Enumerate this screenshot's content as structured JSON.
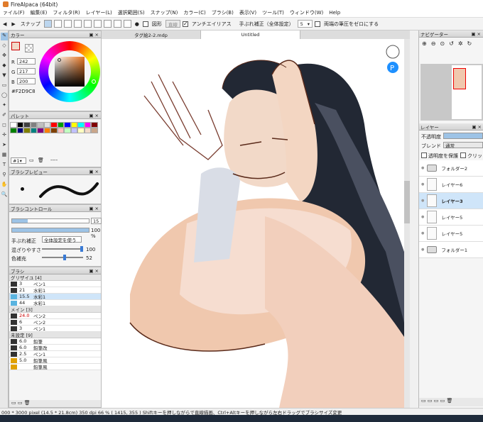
{
  "window": {
    "title": "FireAlpaca (64bit)"
  },
  "menu": [
    "ァイル(F)",
    "編集(E)",
    "フィルタ(R)",
    "レイヤー(L)",
    "選択範囲(S)",
    "スナップ(N)",
    "カラー(C)",
    "ブラシ(B)",
    "表示(V)",
    "ツール(T)",
    "ウィンドウ(W)",
    "Help"
  ],
  "toolbar": {
    "snap_label": "スナップ",
    "shape_label": "図形",
    "shape_select": "直線",
    "antialias_label": "アンチエイリアス",
    "stabilizer_label": "手ぶれ補正（全体設定）",
    "stabilizer_value": "5",
    "pressure_label": "両端の筆圧をゼロにする"
  },
  "color_panel": {
    "title": "カラー",
    "r_label": "R",
    "r": "242",
    "g_label": "G",
    "g": "217",
    "b_label": "B",
    "b": "200",
    "hex": "#F2D9C8"
  },
  "palette_panel": {
    "title": "パレット",
    "swatches": [
      "#ffffff",
      "#000000",
      "#404040",
      "#808080",
      "#c0c0c0",
      "#e0e0e0",
      "#ff0000",
      "#00a000",
      "#0000ff",
      "#ffff00",
      "#00ffff",
      "#ff00ff",
      "#800000",
      "#008000",
      "#000080",
      "#808000",
      "#008080",
      "#800080",
      "#ff8000",
      "#804000",
      "#ffc0c0",
      "#c0ffc0",
      "#c0c0ff",
      "#ffffc0",
      "#f2d9c8",
      "#caa68a"
    ],
    "select_value": "#1",
    "placeholder": "----"
  },
  "brush_preview": {
    "title": "ブラシプレビュー"
  },
  "brush_control": {
    "title": "ブラシコントロール",
    "size": "15",
    "opacity": "100 %",
    "stabilizer_label": "手ぶれ補正",
    "stabilizer_value": "全体設定を使う",
    "blend_label": "混ざりやすさ",
    "blend_value": "100",
    "color_label": "色補充",
    "color_value": "52"
  },
  "brush_panel": {
    "title": "ブラシ",
    "groups": [
      {
        "name": "グリザイユ [4]",
        "items": [
          {
            "size": "3",
            "name": "ペン1",
            "color": "#333333"
          },
          {
            "size": "21",
            "name": "水彩1",
            "color": "#333333"
          },
          {
            "size": "15.5",
            "name": "水彩1",
            "color": "#5ab4e0",
            "selected": true
          },
          {
            "size": "44",
            "name": "水彩1",
            "color": "#5ab4e0"
          }
        ]
      },
      {
        "name": "メイン [3]",
        "items": [
          {
            "size": "24.0",
            "name": "ペン2",
            "color": "#333333",
            "red": true
          },
          {
            "size": "6",
            "name": "ペン2",
            "color": "#333333"
          },
          {
            "size": "3",
            "name": "ペン1",
            "color": "#333333"
          }
        ]
      },
      {
        "name": "未設定 [9]",
        "items": [
          {
            "size": "6.0",
            "name": "鉛筆",
            "color": "#333333"
          },
          {
            "size": "6.0",
            "name": "鉛筆改",
            "color": "#333333"
          },
          {
            "size": "2.5",
            "name": "ペン1",
            "color": "#333333"
          },
          {
            "size": "5.0",
            "name": "鉛筆風",
            "color": "#e0a000"
          },
          {
            "size": "",
            "name": "鉛筆風",
            "color": "#e0a000"
          }
        ]
      }
    ]
  },
  "canvas": {
    "tabs": [
      "タグ絵2-2.mdp",
      "Untitled"
    ],
    "active_tab": "Untitled"
  },
  "navigator": {
    "title": "ナビゲーター"
  },
  "layers": {
    "title": "レイヤー",
    "opacity_label": "不透明度",
    "blend_label": "ブレンド",
    "blend_value": "通常",
    "protect_label": "透明度を保護",
    "clip_label": "クリッピン",
    "items": [
      {
        "name": "フォルダー2",
        "type": "folder"
      },
      {
        "name": "レイヤー6",
        "type": "layer"
      },
      {
        "name": "レイヤー3",
        "type": "layer",
        "selected": true
      },
      {
        "name": "レイヤー5",
        "type": "layer"
      },
      {
        "name": "レイヤー5",
        "type": "layer"
      },
      {
        "name": "フォルダー1",
        "type": "folder"
      }
    ]
  },
  "status": {
    "text": "000 * 3000 pixel  (14.5 * 21.8cm)  350 dpi  66 %  ( 1415, 355 )  Shiftキーを押しながらで直線描画、Ctrl+Altキーを押しながら左右ドラッグでブラシサイズ変更"
  },
  "colors": {
    "accent": "#9dc3e6",
    "skin": "#f2d9c8",
    "hair": "#1f2530",
    "line": "#5a2a1a"
  }
}
